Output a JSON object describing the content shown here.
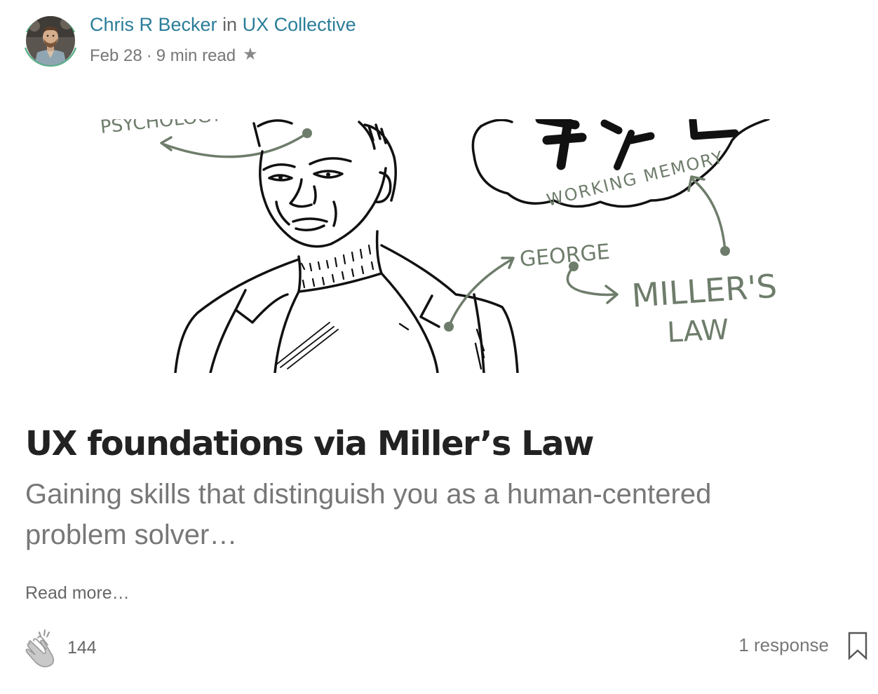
{
  "post": {
    "author": "Chris R Becker",
    "in_label": "in",
    "publication": "UX Collective",
    "date": "Feb 28",
    "separator": "·",
    "read_time": "9 min read",
    "star_glyph": "★",
    "title": "UX foundations via Miller’s Law",
    "subtitle": "Gaining skills that distinguish you as a human-centered problem solver…",
    "read_more": "Read more…"
  },
  "illustration": {
    "labels": {
      "psychology": "PSYCHOLOGY",
      "working_memory": "WORKING MEMORY",
      "george": "GEORGE",
      "millers": "MILLER'S",
      "law": "LAW"
    }
  },
  "footer": {
    "claps": "144",
    "responses": "1 response"
  },
  "colors": {
    "accent": "#2a7d99",
    "avatar_ring": "#5cb08a",
    "sketch_green": "#6e7d6b",
    "sketch_ink": "#111111",
    "text_muted": "#777777"
  },
  "icons": {
    "avatar": "author-avatar",
    "star": "star-icon",
    "clap": "clap-hands-icon",
    "bookmark": "bookmark-icon"
  }
}
